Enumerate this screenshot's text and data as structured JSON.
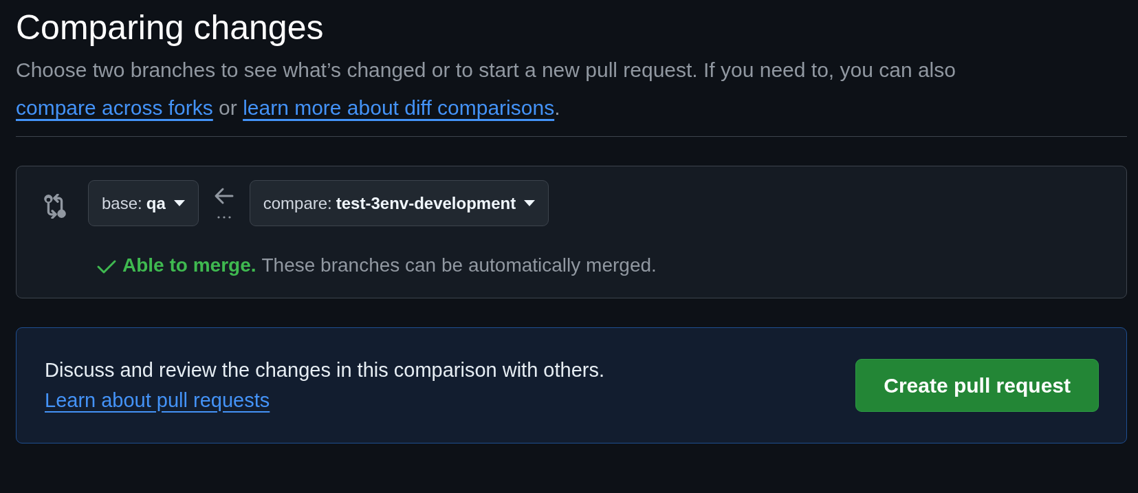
{
  "heading": "Comparing changes",
  "intro": [
    {
      "kind": "text",
      "text": "Choose two branches to see what’s changed or to start a new pull request. If you need to, you can also "
    },
    {
      "kind": "link",
      "text": "compare across forks"
    },
    {
      "kind": "text",
      "text": " or "
    },
    {
      "kind": "link",
      "text": "learn more about diff comparisons"
    },
    {
      "kind": "text",
      "text": "."
    }
  ],
  "base": {
    "prefix": "base:",
    "branch": "qa"
  },
  "compare": {
    "prefix": "compare:",
    "branch": "test-3env-development"
  },
  "status": {
    "mergeable": true,
    "label": "Able to merge.",
    "message": "These branches can be automatically merged."
  },
  "pull_request": {
    "text": "Discuss and review the changes in this comparison with others.",
    "link": "Learn about pull requests",
    "button": "Create pull request"
  }
}
